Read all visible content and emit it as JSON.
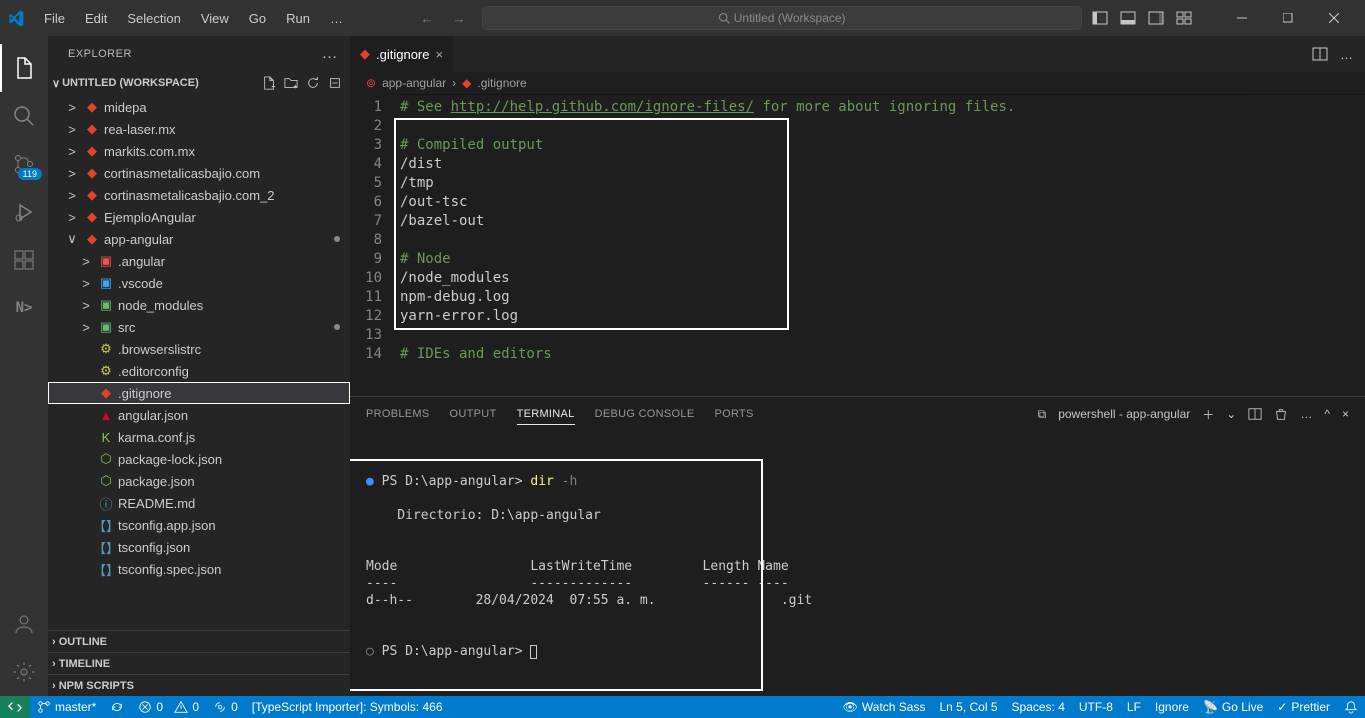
{
  "title": "Untitled (Workspace)",
  "menu": [
    "File",
    "Edit",
    "Selection",
    "View",
    "Go",
    "Run",
    "…"
  ],
  "activitybar_badge": "119",
  "sidebar": {
    "header": "EXPLORER",
    "workspace": "UNTITLED (WORKSPACE)",
    "folders": [
      {
        "name": "midepa",
        "chev": ">",
        "icon": "git",
        "dot": false,
        "depth": 0
      },
      {
        "name": "rea-laser.mx",
        "chev": ">",
        "icon": "git",
        "dot": false,
        "depth": 0
      },
      {
        "name": "markits.com.mx",
        "chev": ">",
        "icon": "git",
        "dot": false,
        "depth": 0
      },
      {
        "name": "cortinasmetalicasbajio.com",
        "chev": ">",
        "icon": "git",
        "dot": false,
        "depth": 0
      },
      {
        "name": "cortinasmetalicasbajio.com_2",
        "chev": ">",
        "icon": "git",
        "dot": false,
        "depth": 0
      },
      {
        "name": "EjemploAngular",
        "chev": ">",
        "icon": "git",
        "dot": false,
        "depth": 0
      },
      {
        "name": "app-angular",
        "chev": "∨",
        "icon": "git",
        "dot": true,
        "depth": 0
      },
      {
        "name": ".angular",
        "chev": ">",
        "icon": "folder-red",
        "dot": false,
        "depth": 1
      },
      {
        "name": ".vscode",
        "chev": ">",
        "icon": "folder-blue",
        "dot": false,
        "depth": 1
      },
      {
        "name": "node_modules",
        "chev": ">",
        "icon": "folder-green",
        "dot": false,
        "depth": 1
      },
      {
        "name": "src",
        "chev": ">",
        "icon": "folder-green",
        "dot": true,
        "depth": 1
      },
      {
        "name": ".browserslistrc",
        "chev": "",
        "icon": "yellow",
        "dot": false,
        "depth": 1
      },
      {
        "name": ".editorconfig",
        "chev": "",
        "icon": "yellow",
        "dot": false,
        "depth": 1
      },
      {
        "name": ".gitignore",
        "chev": "",
        "icon": "git",
        "dot": false,
        "depth": 1,
        "selected": true,
        "highlighted": true
      },
      {
        "name": "angular.json",
        "chev": "",
        "icon": "angular",
        "dot": false,
        "depth": 1
      },
      {
        "name": "karma.conf.js",
        "chev": "",
        "icon": "karma",
        "dot": false,
        "depth": 1
      },
      {
        "name": "package-lock.json",
        "chev": "",
        "icon": "node",
        "dot": false,
        "depth": 1
      },
      {
        "name": "package.json",
        "chev": "",
        "icon": "node",
        "dot": false,
        "depth": 1
      },
      {
        "name": "README.md",
        "chev": "",
        "icon": "info",
        "dot": false,
        "depth": 1
      },
      {
        "name": "tsconfig.app.json",
        "chev": "",
        "icon": "ts",
        "dot": false,
        "depth": 1
      },
      {
        "name": "tsconfig.json",
        "chev": "",
        "icon": "ts",
        "dot": false,
        "depth": 1
      },
      {
        "name": "tsconfig.spec.json",
        "chev": "",
        "icon": "ts",
        "dot": false,
        "depth": 1
      }
    ],
    "sections": [
      "OUTLINE",
      "TIMELINE",
      "NPM SCRIPTS"
    ]
  },
  "tabs": [
    {
      "name": ".gitignore",
      "icon": "git"
    }
  ],
  "breadcrumbs": [
    {
      "icon": "git",
      "label": "app-angular"
    },
    {
      "icon": "git",
      "label": ".gitignore"
    }
  ],
  "editor_lines": [
    {
      "n": 1,
      "c": "comment",
      "t": "# See ",
      "link": "http://help.github.com/ignore-files/",
      "after": " for more about ignoring files."
    },
    {
      "n": 2,
      "c": "",
      "t": ""
    },
    {
      "n": 3,
      "c": "comment",
      "t": "# Compiled output"
    },
    {
      "n": 4,
      "c": "",
      "t": "/dist"
    },
    {
      "n": 5,
      "c": "",
      "t": "/tmp"
    },
    {
      "n": 6,
      "c": "",
      "t": "/out-tsc"
    },
    {
      "n": 7,
      "c": "",
      "t": "/bazel-out"
    },
    {
      "n": 8,
      "c": "",
      "t": ""
    },
    {
      "n": 9,
      "c": "comment",
      "t": "# Node"
    },
    {
      "n": 10,
      "c": "",
      "t": "/node_modules"
    },
    {
      "n": 11,
      "c": "",
      "t": "npm-debug.log"
    },
    {
      "n": 12,
      "c": "",
      "t": "yarn-error.log"
    },
    {
      "n": 13,
      "c": "",
      "t": ""
    },
    {
      "n": 14,
      "c": "comment",
      "t": "# IDEs and editors"
    }
  ],
  "panel": {
    "tabs": [
      "PROBLEMS",
      "OUTPUT",
      "TERMINAL",
      "DEBUG CONSOLE",
      "PORTS"
    ],
    "active": 2,
    "shell": "powershell - app-angular",
    "lines": [
      {
        "type": "prompt",
        "prompt": "PS D:\\app-angular> ",
        "cmd": "dir",
        "arg": " -h",
        "dot": true
      },
      {
        "type": "blank"
      },
      {
        "type": "out",
        "t": "    Directorio: D:\\app-angular"
      },
      {
        "type": "blank"
      },
      {
        "type": "blank"
      },
      {
        "type": "out",
        "t": "Mode                 LastWriteTime         Length Name"
      },
      {
        "type": "out",
        "t": "----                 -------------         ------ ----"
      },
      {
        "type": "out",
        "t": "d--h--        28/04/2024  07:55 a. m.                .git"
      },
      {
        "type": "blank"
      },
      {
        "type": "blank"
      },
      {
        "type": "prompt2",
        "prompt": "PS D:\\app-angular> ",
        "cursor": true
      }
    ]
  },
  "status": {
    "branch": "master*",
    "sync": "↓↑",
    "errors": "0",
    "warnings": "0",
    "port": "0",
    "importer": "[TypeScript Importer]: Symbols: 466",
    "right": [
      "Watch Sass",
      "Ln 5, Col 5",
      "Spaces: 4",
      "UTF-8",
      "LF",
      "Ignore",
      "Go Live",
      "Prettier"
    ]
  }
}
